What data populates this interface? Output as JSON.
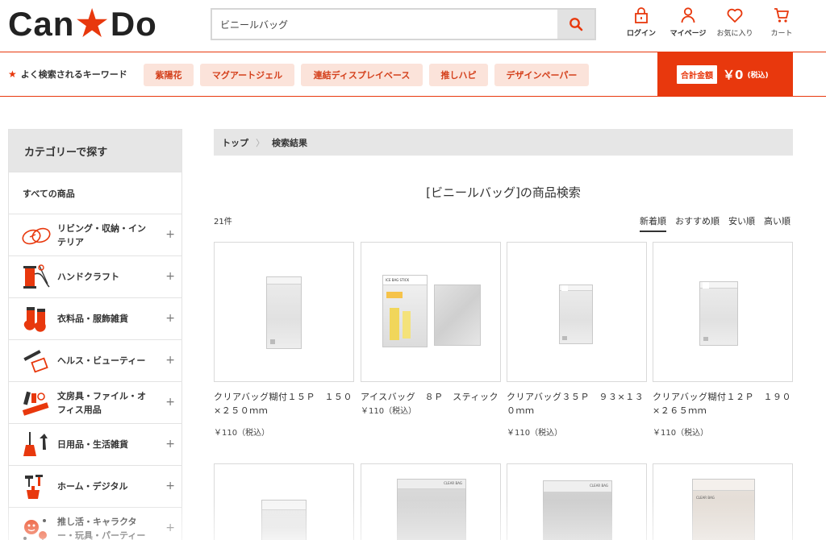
{
  "logo": {
    "left": "Can",
    "right": "Do"
  },
  "search": {
    "value": "ビニールバッグ",
    "placeholder": ""
  },
  "header_icons": [
    {
      "label": "ログイン",
      "icon": "lock-icon"
    },
    {
      "label": "マイページ",
      "icon": "user-icon"
    },
    {
      "label": "お気に入り",
      "icon": "heart-icon"
    },
    {
      "label": "カート",
      "icon": "cart-icon"
    }
  ],
  "keywords": {
    "title": "よく検索されるキーワード",
    "items": [
      "紫陽花",
      "マグアートジェル",
      "連結ディスプレイベース",
      "推しハピ",
      "デザインペーパー"
    ]
  },
  "total": {
    "label": "合計金額",
    "value": "￥0",
    "tax": "(税込)"
  },
  "sidebar": {
    "title": "カテゴリーで探す",
    "all": "すべての商品",
    "categories": [
      {
        "line1": "リビング・収納・イン",
        "line2": "テリア",
        "icon": "living-icon"
      },
      {
        "line1": "ハンドクラフト",
        "line2": "",
        "icon": "handcraft-icon"
      },
      {
        "line1": "衣料品・服飾雑貨",
        "line2": "",
        "icon": "socks-icon"
      },
      {
        "line1": "ヘルス・ビューティー",
        "line2": "",
        "icon": "beauty-icon"
      },
      {
        "line1": "文房具・ファイル・オ",
        "line2": "フィス用品",
        "icon": "stationery-icon"
      },
      {
        "line1": "日用品・生活雑貨",
        "line2": "",
        "icon": "broom-icon"
      },
      {
        "line1": "ホーム・デジタル",
        "line2": "",
        "icon": "tools-icon"
      },
      {
        "line1": "推し活・キャラクタ",
        "line2": "ー・玩具・パーティー",
        "icon": "party-icon"
      }
    ],
    "plus": "+"
  },
  "breadcrumb": {
    "home": "トップ",
    "sep": "〉",
    "current": "検索結果"
  },
  "results": {
    "title": "[ビニールバッグ]の商品検索",
    "count": "21件",
    "sorts": [
      "新着順",
      "おすすめ順",
      "安い順",
      "高い順"
    ],
    "active_sort": "新着順"
  },
  "products": [
    {
      "line1": "クリアバッグ糊付１５Ｐ　１５０",
      "line2": "×２５０ｍｍ",
      "price": "￥110（税込）"
    },
    {
      "line1": "アイスバッグ　８Ｐ　スティック",
      "line2": "",
      "price": "￥110（税込）"
    },
    {
      "line1": "クリアバッグ３５Ｐ　９３×１３",
      "line2": "０ｍｍ",
      "price": "￥110（税込）"
    },
    {
      "line1": "クリアバッグ糊付１２Ｐ　１９０",
      "line2": "×２６５ｍｍ",
      "price": "￥110（税込）"
    }
  ],
  "product_thumb_labels": {
    "ice_pack": "ICE BAG STICK",
    "clear_bag": "CLEAR BAG"
  },
  "colors": {
    "accent": "#e8380d",
    "chip_bg": "#fbe3da",
    "chip_text": "#d4401c",
    "gray_bg": "#e6e6e6"
  }
}
